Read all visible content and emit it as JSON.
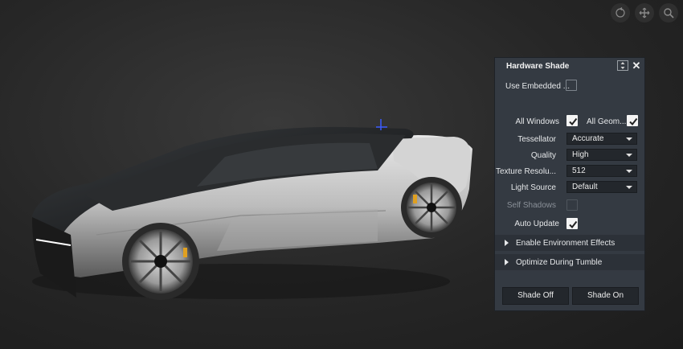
{
  "viewport": {
    "nav_icons": [
      "rotate-icon",
      "pan-icon",
      "zoom-icon"
    ]
  },
  "panel": {
    "title": "Hardware Shade",
    "use_embedded_label": "Use Embedded ...",
    "use_embedded_checked": false,
    "all_windows_label": "All Windows",
    "all_windows_checked": true,
    "all_geom_label": "All Geom...",
    "all_geom_checked": true,
    "tessellator_label": "Tessellator",
    "tessellator_value": "Accurate",
    "quality_label": "Quality",
    "quality_value": "High",
    "texture_res_label": "Texture Resolu...",
    "texture_res_value": "512",
    "light_source_label": "Light Source",
    "light_source_value": "Default",
    "self_shadows_label": "Self Shadows",
    "self_shadows_checked": false,
    "auto_update_label": "Auto Update",
    "auto_update_checked": true,
    "section_env": "Enable Environment Effects",
    "section_tumble": "Optimize During Tumble",
    "shade_off": "Shade Off",
    "shade_on": "Shade On"
  },
  "colors": {
    "panel_bg": "#343a42",
    "section_bg": "#2c3138",
    "field_bg": "#23272c",
    "caliper_accent": "#e0a020"
  }
}
